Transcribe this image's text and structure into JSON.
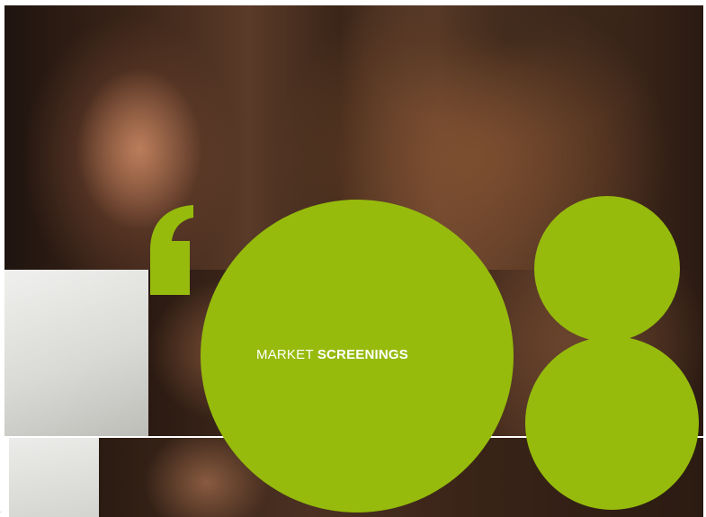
{
  "headline": {
    "word_light": "MARKET",
    "word_bold": "SCREENINGS"
  },
  "page_mark": ".",
  "colors": {
    "accent_green": "#96bb0c",
    "text_on_green": "#ffffff"
  },
  "graphics": {
    "quote_icon": "opening-quote-icon",
    "number_graphic": "figure-eight-icon"
  }
}
